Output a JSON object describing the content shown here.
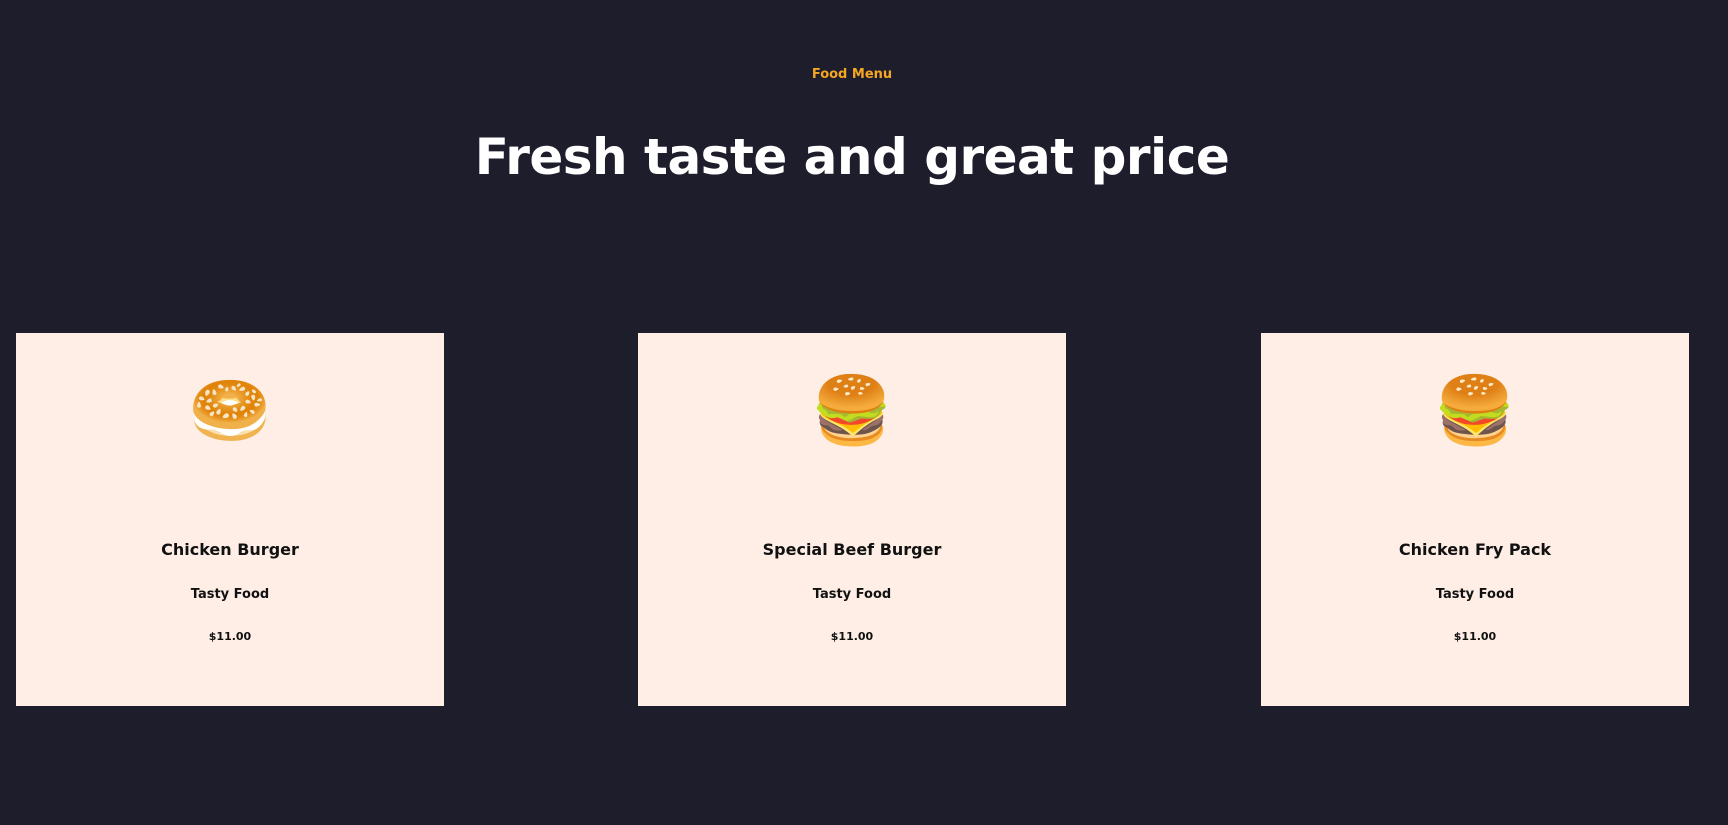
{
  "section": {
    "eyebrow": "Food Menu",
    "heading": "Fresh taste and great price"
  },
  "items": [
    {
      "name": "Chicken Burger",
      "tag": "Tasty Food",
      "price": "$11.00",
      "icon": "bagel-sandwich-icon",
      "glyph": "🥯"
    },
    {
      "name": "Special Beef Burger",
      "tag": "Tasty Food",
      "price": "$11.00",
      "icon": "burger-icon",
      "glyph": "🍔"
    },
    {
      "name": "Chicken Fry Pack",
      "tag": "Tasty Food",
      "price": "$11.00",
      "icon": "burger-icon",
      "glyph": "🍔"
    }
  ],
  "colors": {
    "background": "#1e1d2b",
    "accent": "#f5a623",
    "card": "#ffeee6"
  }
}
